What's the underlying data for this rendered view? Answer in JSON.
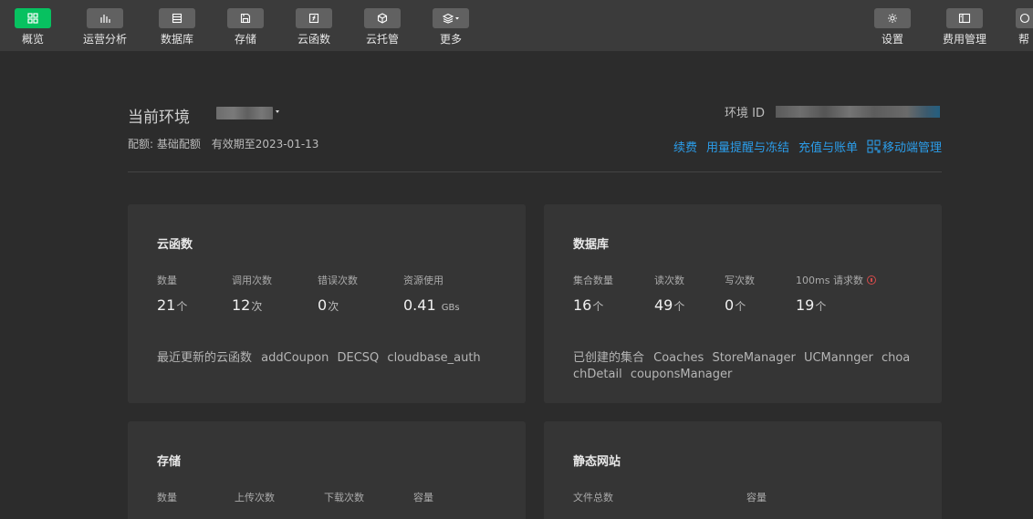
{
  "toolbar": {
    "left_items": [
      {
        "label": "概览",
        "icon": "grid-icon"
      },
      {
        "label": "运营分析",
        "icon": "bar-chart-icon"
      },
      {
        "label": "数据库",
        "icon": "database-icon"
      },
      {
        "label": "存储",
        "icon": "floppy-icon"
      },
      {
        "label": "云函数",
        "icon": "function-icon"
      },
      {
        "label": "云托管",
        "icon": "cube-icon"
      },
      {
        "label": "更多",
        "icon": "layers-icon"
      }
    ],
    "right_items": [
      {
        "label": "设置",
        "icon": "gear-icon"
      },
      {
        "label": "费用管理",
        "icon": "sidebar-panel-icon"
      },
      {
        "label": "帮",
        "icon": "help-icon"
      }
    ],
    "active_color": "#07c160"
  },
  "env": {
    "title": "当前环境",
    "quota_label": "配额: 基础配额",
    "validity": "有效期至2023-01-13",
    "id_label": "环境 ID"
  },
  "links": {
    "renew": "续费",
    "usage_alert": "用量提醒与冻结",
    "recharge": "充值与账单",
    "mobile_admin": "移动端管理",
    "color": "#2b9dea"
  },
  "cards": {
    "cloud_functions": {
      "title": "云函数",
      "stats": [
        {
          "label": "数量",
          "value": "21",
          "unit": "个"
        },
        {
          "label": "调用次数",
          "value": "12",
          "unit": "次"
        },
        {
          "label": "错误次数",
          "value": "0",
          "unit": "次"
        },
        {
          "label": "资源使用",
          "value": "0.41",
          "unit": "GBs"
        }
      ],
      "recent_label": "最近更新的云函数",
      "recent_items": [
        "addCoupon",
        "DECSQ",
        "cloudbase_auth"
      ]
    },
    "database": {
      "title": "数据库",
      "stats": [
        {
          "label": "集合数量",
          "value": "16",
          "unit": "个"
        },
        {
          "label": "读次数",
          "value": "49",
          "unit": "个"
        },
        {
          "label": "写次数",
          "value": "0",
          "unit": "个"
        },
        {
          "label": "100ms 请求数",
          "value": "19",
          "unit": "个"
        }
      ],
      "recent_label": "已创建的集合",
      "recent_items": [
        "Coaches",
        "StoreManager",
        "UCMannger",
        "choachDetail",
        "couponsManager"
      ]
    },
    "storage": {
      "title": "存储",
      "stats": [
        {
          "label": "数量"
        },
        {
          "label": "上传次数"
        },
        {
          "label": "下载次数"
        },
        {
          "label": "容量"
        }
      ]
    },
    "static_site": {
      "title": "静态网站",
      "stats": [
        {
          "label": "文件总数"
        },
        {
          "label": "容量"
        }
      ]
    }
  }
}
